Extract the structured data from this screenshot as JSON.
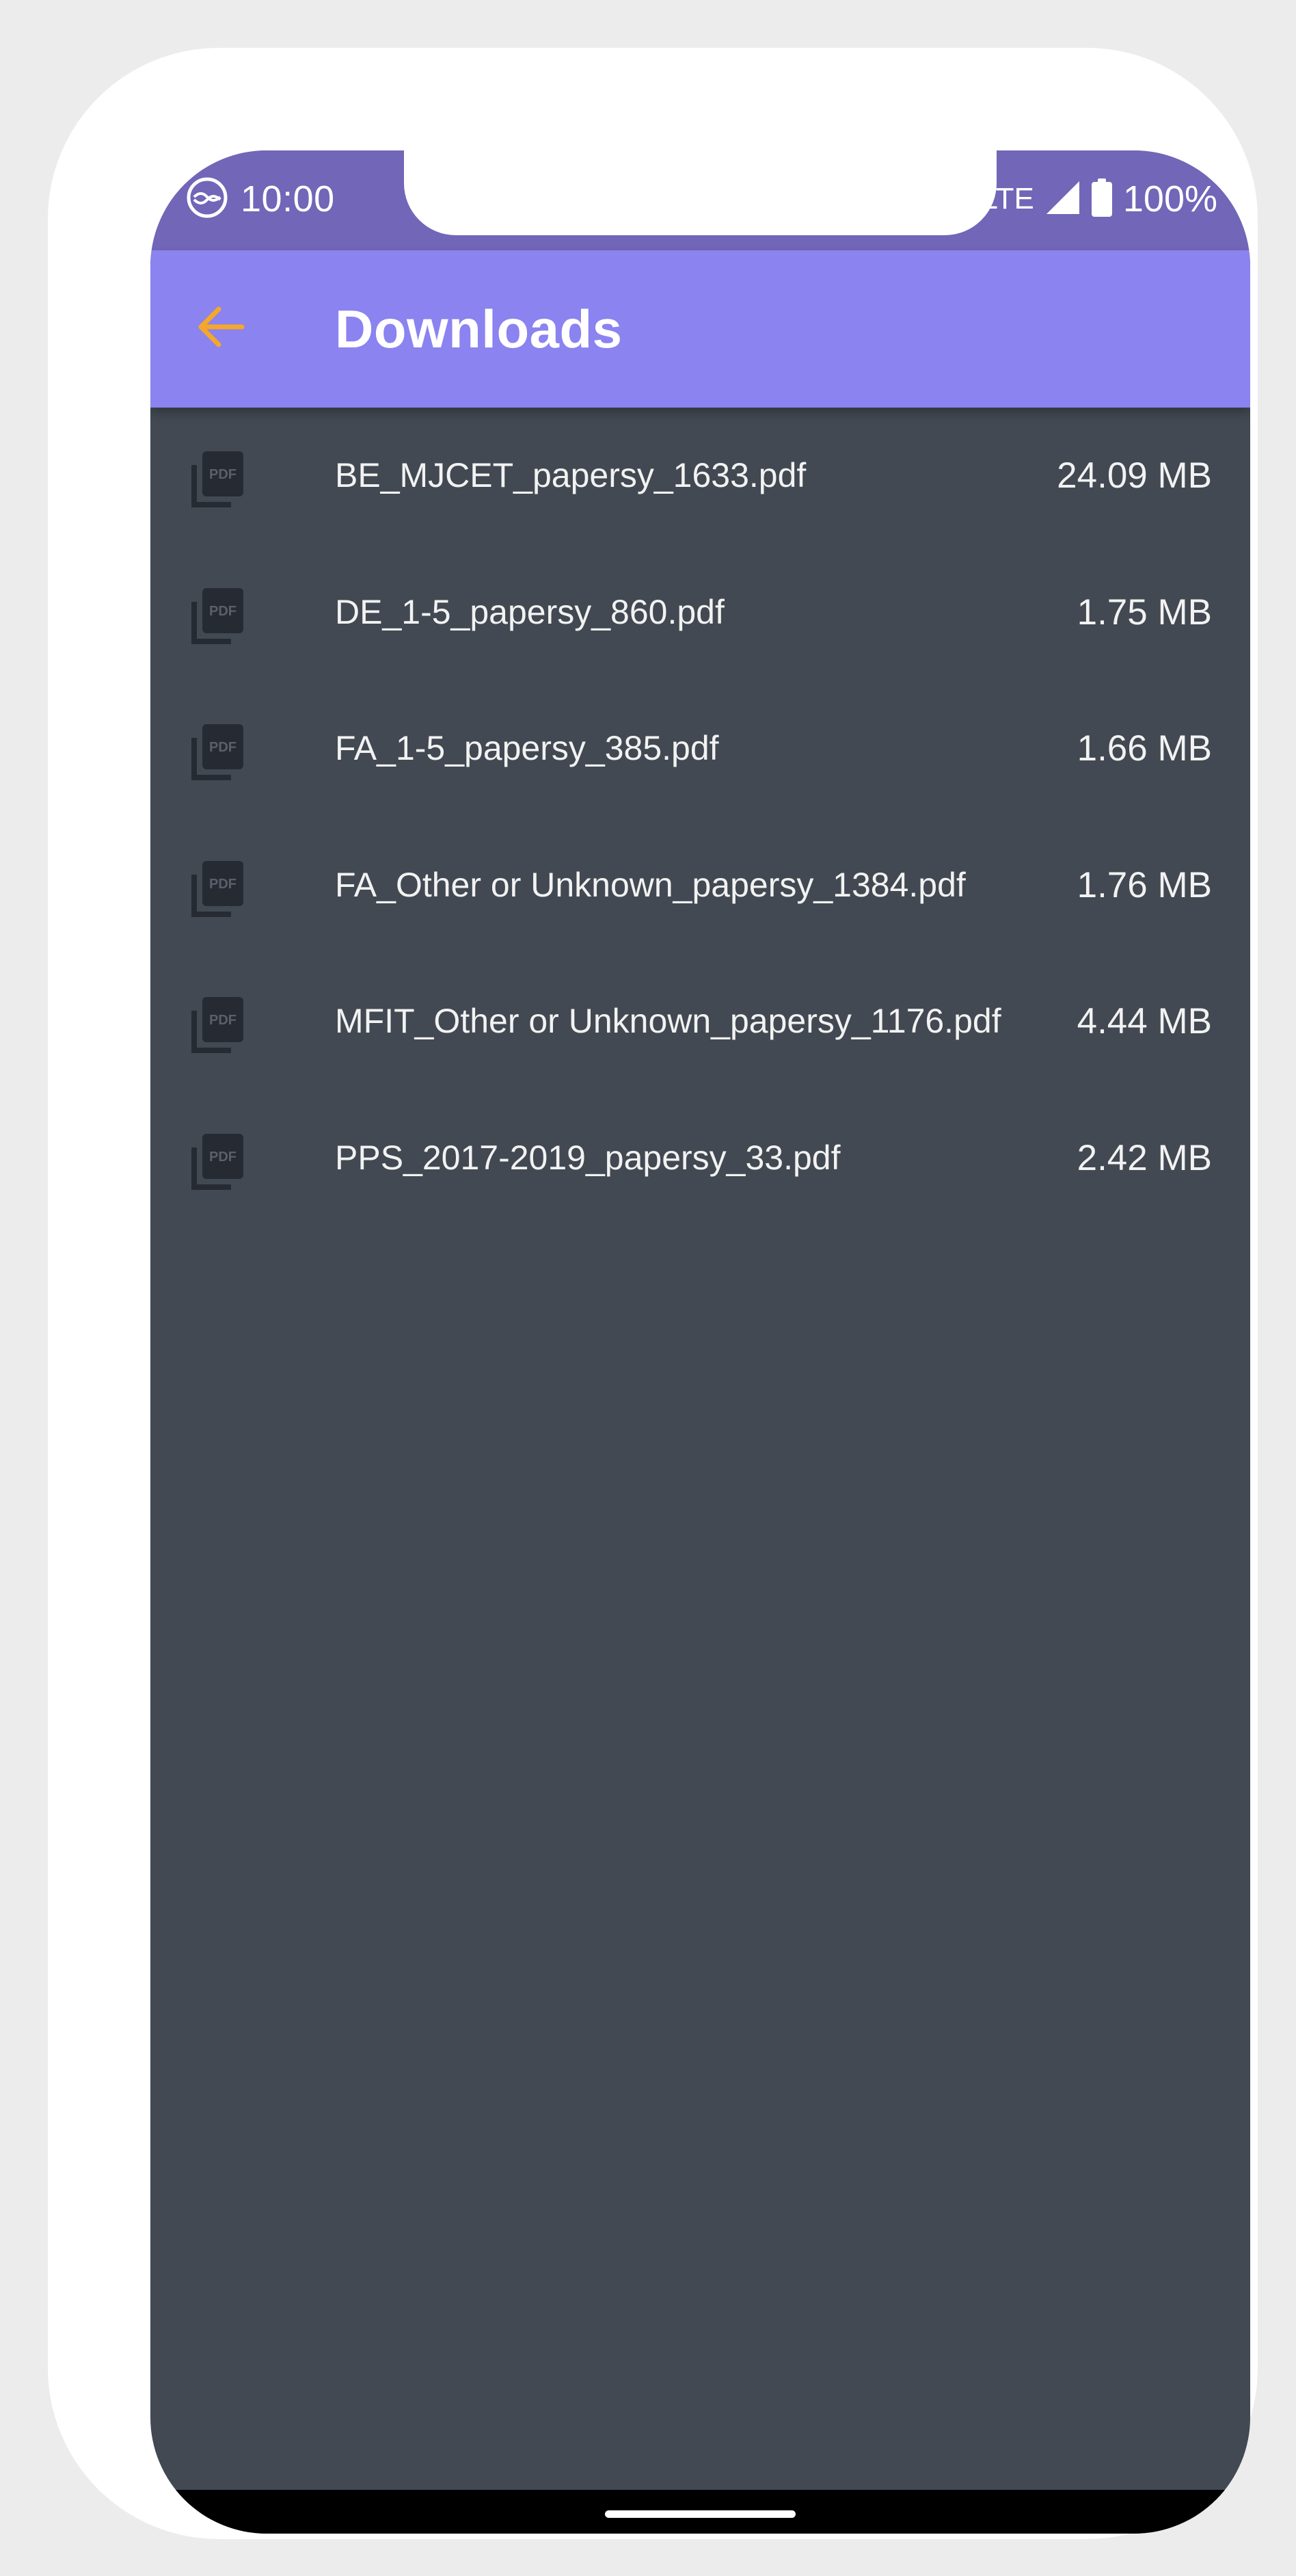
{
  "status_bar": {
    "time": "10:00",
    "network": "LTE",
    "battery": "100%",
    "icons": [
      "notification-app-icon",
      "signal-icon",
      "battery-icon"
    ]
  },
  "app_bar": {
    "title": "Downloads",
    "back_icon": "arrow-left-icon",
    "back_color": "#f4a72a",
    "background": "#8b83ef"
  },
  "files": [
    {
      "name": "BE_MJCET_papersy_1633.pdf",
      "size": "24.09 MB",
      "icon": "pdf-file-icon"
    },
    {
      "name": "DE_1-5_papersy_860.pdf",
      "size": "1.75 MB",
      "icon": "pdf-file-icon"
    },
    {
      "name": "FA_1-5_papersy_385.pdf",
      "size": "1.66 MB",
      "icon": "pdf-file-icon"
    },
    {
      "name": "FA_Other or Unknown_papersy_1384.pdf",
      "size": "1.76 MB",
      "icon": "pdf-file-icon"
    },
    {
      "name": "MFIT_Other or Unknown_papersy_1176.pdf",
      "size": "4.44 MB",
      "icon": "pdf-file-icon"
    },
    {
      "name": "PPS_2017-2019_papersy_33.pdf",
      "size": "2.42 MB",
      "icon": "pdf-file-icon"
    }
  ],
  "colors": {
    "status_bar": "#7166b8",
    "list_background": "#424952",
    "text": "#f2f2f2",
    "icon": "#262a33"
  }
}
